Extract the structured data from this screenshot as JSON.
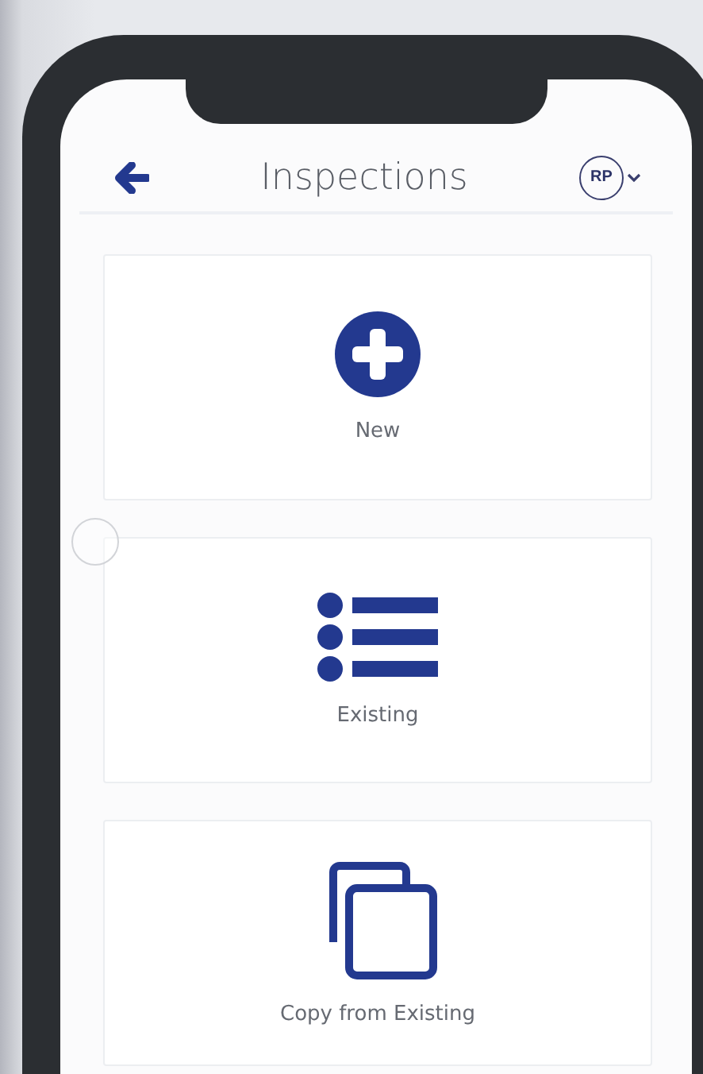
{
  "header": {
    "title": "Inspections",
    "avatar_initials": "RP"
  },
  "options": [
    {
      "kind": "new",
      "label": "New"
    },
    {
      "kind": "list",
      "label": "Existing"
    },
    {
      "kind": "copy",
      "label": "Copy from Existing"
    }
  ]
}
